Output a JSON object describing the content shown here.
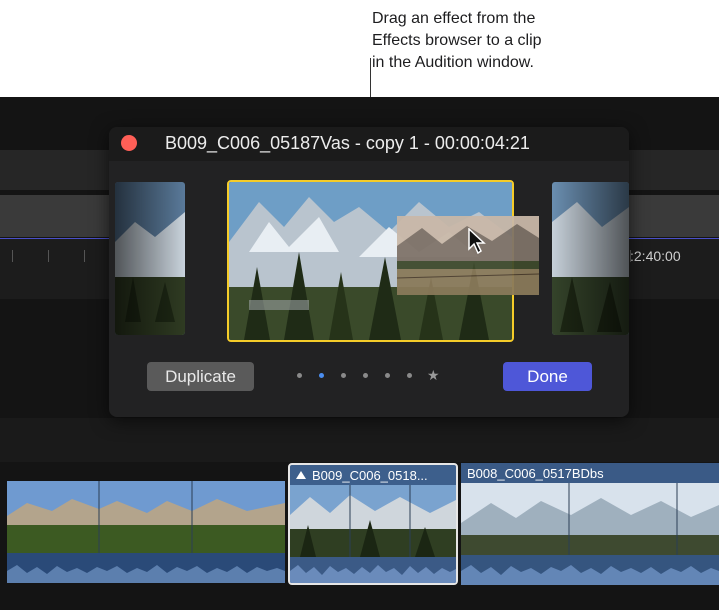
{
  "callout": {
    "text": "Drag an effect from the\nEffects browser to a clip\nin the Audition window."
  },
  "audition_window": {
    "title": "B009_C006_05187Vas - copy 1 - 00:00:04:21",
    "duplicate_label": "Duplicate",
    "done_label": "Done",
    "page_dots": 7,
    "active_dot": 1,
    "favorite_symbol": "★"
  },
  "timeline": {
    "timecode": ":2:40:00",
    "clips": [
      {
        "label": ""
      },
      {
        "label": "B009_C006_0518..."
      },
      {
        "label": "B008_C006_0517BDbs"
      }
    ]
  },
  "colors": {
    "selection_yellow": "#f5cc29",
    "done_blue": "#4e57d8",
    "active_dot": "#4b8ef0",
    "close_red": "#ff5f57"
  }
}
